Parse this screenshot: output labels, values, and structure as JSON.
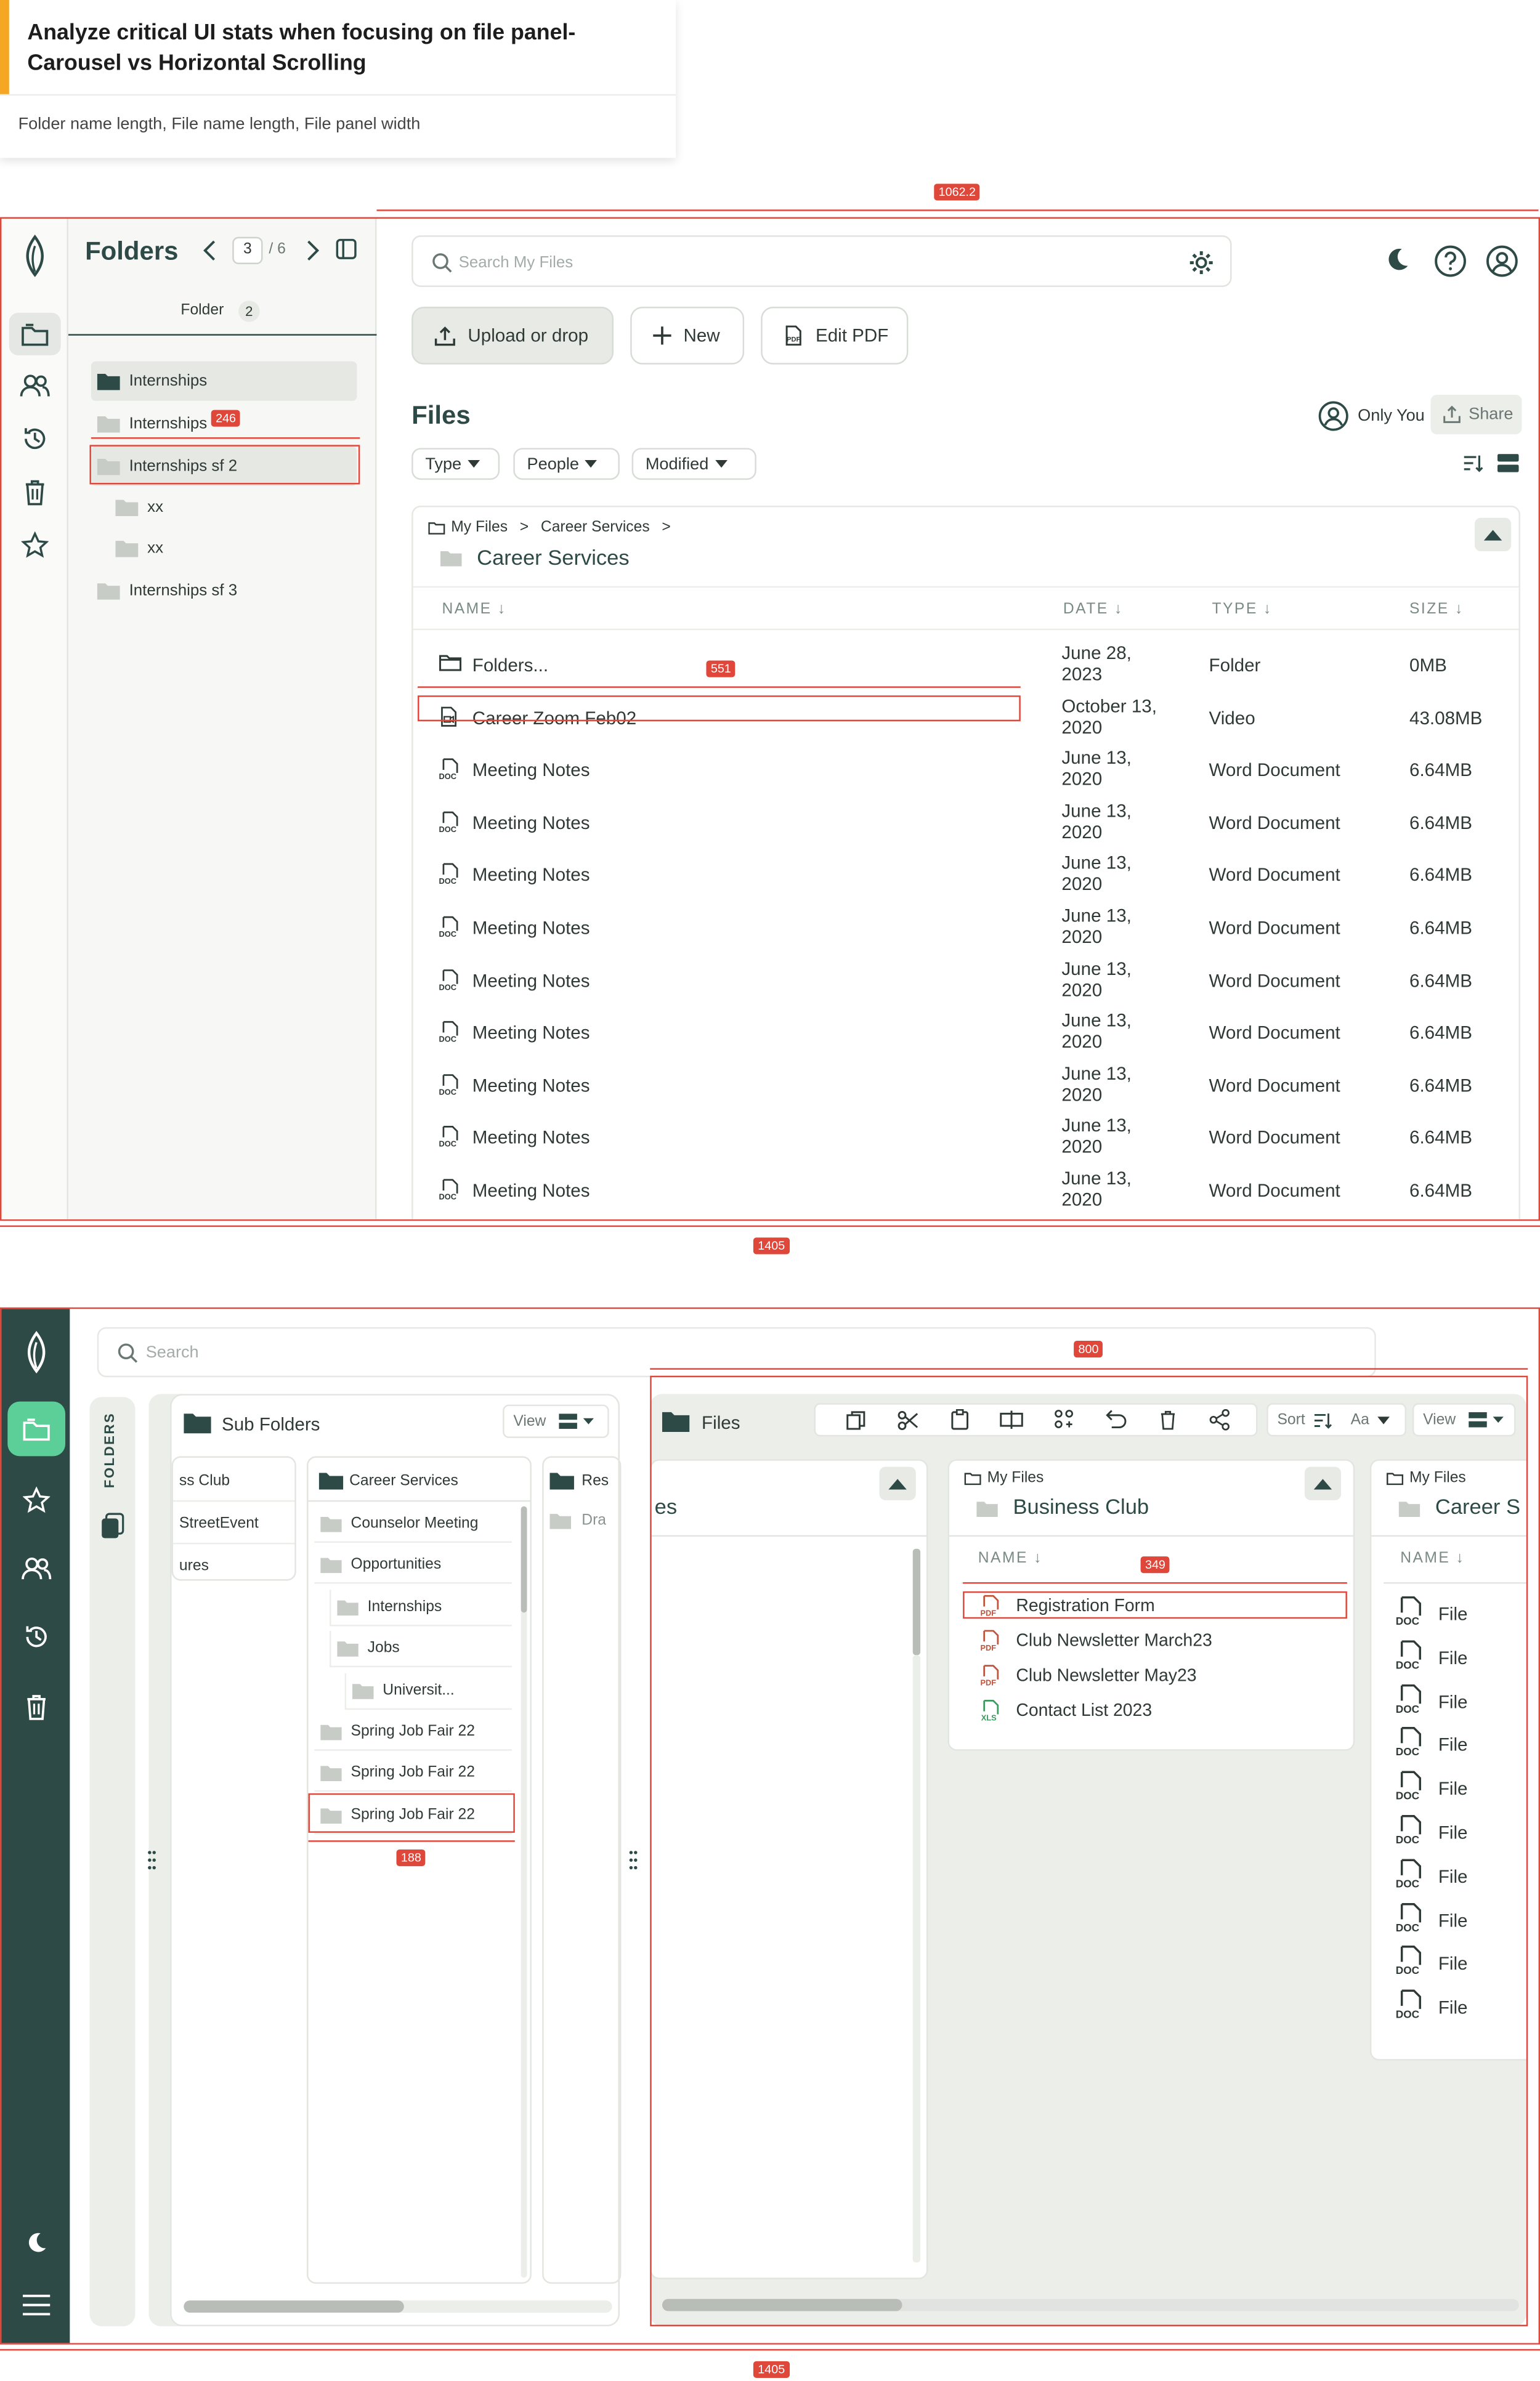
{
  "heading": {
    "title": "Analyze critical UI stats when focusing on file panel- Carousel vs Horizontal Scrolling",
    "subtitle": "Folder name length, File name length, File panel width"
  },
  "measurements": {
    "top_panel_width": "1062.2",
    "top_total_width": "1405",
    "folder_name_width": "246",
    "file_name_width": "551",
    "bottom_panel_width": "800",
    "bottom_total_width": "1405",
    "subfolder_width": "188",
    "filename2_width": "349"
  },
  "top": {
    "folders_title": "Folders",
    "page_current": "3",
    "page_total": "/ 6",
    "folder_label": "Folder",
    "folder_count": "2",
    "tree": [
      {
        "label": "Internships",
        "level": 0,
        "state": "selected"
      },
      {
        "label": "Internships",
        "level": 0,
        "state": "normal"
      },
      {
        "label": "Internships sf 2",
        "level": 0,
        "state": "highlight"
      },
      {
        "label": "xx",
        "level": 1,
        "state": "normal"
      },
      {
        "label": "xx",
        "level": 1,
        "state": "normal"
      },
      {
        "label": "Internships sf 3",
        "level": 0,
        "state": "normal"
      }
    ],
    "search_placeholder": "Search My Files",
    "upload_label": "Upload or drop",
    "new_label": "New",
    "editpdf_label": "Edit PDF",
    "files_title": "Files",
    "only_you": "Only You",
    "share_label": "Share",
    "filters": [
      "Type",
      "People",
      "Modified"
    ],
    "breadcrumb": {
      "root": "My Files",
      "child": "Career Services"
    },
    "current_folder": "Career Services",
    "columns": {
      "name": "NAME",
      "date": "DATE",
      "type": "TYPE",
      "size": "SIZE"
    },
    "rows": [
      {
        "name": "Folders...",
        "date1": "June 28,",
        "date2": "2023",
        "type": "Folder",
        "size": "0MB",
        "icon": "folder"
      },
      {
        "name": "Career Zoom Feb02",
        "date1": "October 13,",
        "date2": "2020",
        "type": "Video",
        "size": "43.08MB",
        "icon": "video"
      },
      {
        "name": "Meeting Notes",
        "date1": "June 13,",
        "date2": "2020",
        "type": "Word Document",
        "size": "6.64MB",
        "icon": "doc"
      },
      {
        "name": "Meeting Notes",
        "date1": "June 13,",
        "date2": "2020",
        "type": "Word Document",
        "size": "6.64MB",
        "icon": "doc"
      },
      {
        "name": "Meeting Notes",
        "date1": "June 13,",
        "date2": "2020",
        "type": "Word Document",
        "size": "6.64MB",
        "icon": "doc"
      },
      {
        "name": "Meeting Notes",
        "date1": "June 13,",
        "date2": "2020",
        "type": "Word Document",
        "size": "6.64MB",
        "icon": "doc"
      },
      {
        "name": "Meeting Notes",
        "date1": "June 13,",
        "date2": "2020",
        "type": "Word Document",
        "size": "6.64MB",
        "icon": "doc"
      },
      {
        "name": "Meeting Notes",
        "date1": "June 13,",
        "date2": "2020",
        "type": "Word Document",
        "size": "6.64MB",
        "icon": "doc"
      },
      {
        "name": "Meeting Notes",
        "date1": "June 13,",
        "date2": "2020",
        "type": "Word Document",
        "size": "6.64MB",
        "icon": "doc"
      },
      {
        "name": "Meeting Notes",
        "date1": "June 13,",
        "date2": "2020",
        "type": "Word Document",
        "size": "6.64MB",
        "icon": "doc"
      },
      {
        "name": "Meeting Notes",
        "date1": "June 13,",
        "date2": "2020",
        "type": "Word Document",
        "size": "6.64MB",
        "icon": "doc"
      }
    ]
  },
  "bottom": {
    "search_placeholder": "Search",
    "folders_tab": "FOLDERS",
    "subfolders_title": "Sub Folders",
    "view_label": "View",
    "col1": [
      "ss Club",
      "StreetEvent",
      "ures"
    ],
    "col2_header": "Career Services",
    "col2": [
      {
        "label": "Counselor Meeting",
        "level": 0
      },
      {
        "label": "Opportunities",
        "level": 0
      },
      {
        "label": "Internships",
        "level": 1
      },
      {
        "label": "Jobs",
        "level": 1
      },
      {
        "label": "Universit...",
        "level": 2
      },
      {
        "label": "Spring Job Fair 22",
        "level": 0
      },
      {
        "label": "Spring Job Fair 22",
        "level": 0
      },
      {
        "label": "Spring Job Fair 22",
        "level": 0
      }
    ],
    "col3": [
      "Res",
      "Dra"
    ],
    "files_title": "Files",
    "sort_label": "Sort",
    "aa_label": "Aa",
    "panel_partial": "es",
    "panel2": {
      "breadcrumb": "My Files",
      "title": "Business Club",
      "name_header": "NAME",
      "files": [
        {
          "name": "Registration Form",
          "icon": "pdf"
        },
        {
          "name": "Club Newsletter March23",
          "icon": "pdf"
        },
        {
          "name": "Club Newsletter May23",
          "icon": "pdf"
        },
        {
          "name": "Contact List 2023",
          "icon": "xls"
        }
      ]
    },
    "panel3": {
      "breadcrumb": "My Files",
      "title": "Career S",
      "name_header": "NAME",
      "files": [
        "File",
        "File",
        "File",
        "File",
        "File",
        "File",
        "File",
        "File",
        "File",
        "File"
      ]
    }
  },
  "colors": {
    "sidebar_dark": "#2e4a46",
    "accent_green": "#5ccf98",
    "measure_red": "#e0473b",
    "folder_dark": "#2e4a46",
    "folder_gray": "#c8ccc7"
  }
}
